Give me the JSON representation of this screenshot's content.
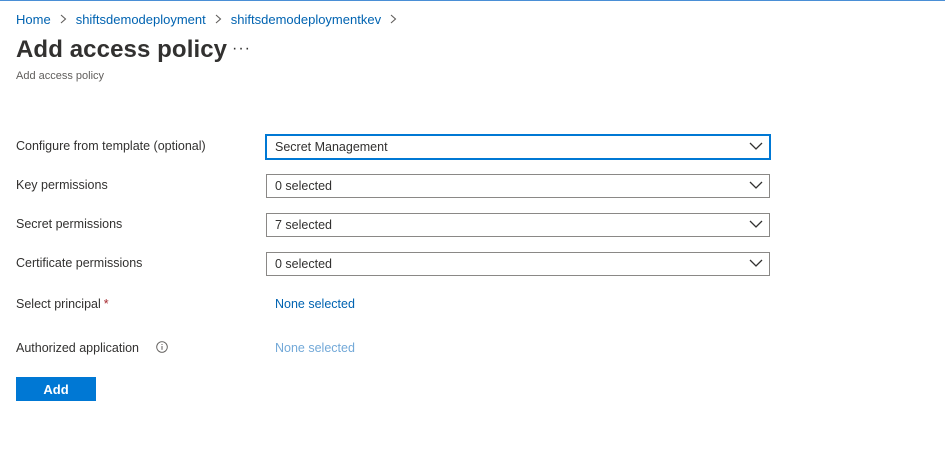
{
  "breadcrumb": [
    {
      "label": "Home"
    },
    {
      "label": "shiftsdemodeployment"
    },
    {
      "label": "shiftsdemodeploymentkev"
    }
  ],
  "page": {
    "title": "Add access policy",
    "more_glyph": "···",
    "subtitle": "Add access policy"
  },
  "form": {
    "template": {
      "label": "Configure from template (optional)",
      "value": "Secret Management"
    },
    "key_permissions": {
      "label": "Key permissions",
      "value": "0 selected"
    },
    "secret_permissions": {
      "label": "Secret permissions",
      "value": "7 selected"
    },
    "certificate_permissions": {
      "label": "Certificate permissions",
      "value": "0 selected"
    },
    "principal": {
      "label": "Select principal",
      "required_mark": "*",
      "value": "None selected"
    },
    "authorized_app": {
      "label": "Authorized application",
      "value": "None selected"
    }
  },
  "actions": {
    "add_label": "Add"
  },
  "colors": {
    "accent": "#0078d4",
    "link": "#0063b1",
    "link_disabled": "#73a9d8",
    "required": "#a4262c"
  },
  "icons": {
    "separator": "chevron-right-icon",
    "dropdown": "chevron-down-icon",
    "info": "info-icon"
  }
}
